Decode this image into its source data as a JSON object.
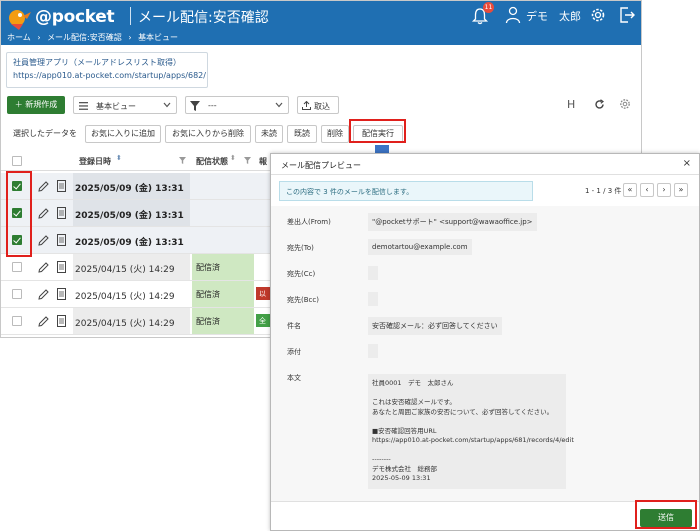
{
  "header": {
    "logo_text": "@pocket",
    "page_title": "メール配信:安否確認",
    "notification_count": "11",
    "user_name": "デモ　太郎",
    "breadcrumb": [
      "ホーム",
      "›",
      "メール配信:安否確認",
      "›",
      "基本ビュー"
    ]
  },
  "app_info": {
    "name": "社員管理アプリ（メールアドレスリスト取得）",
    "url": "https://app010.at-pocket.com/startup/apps/682/"
  },
  "toolbar": {
    "new_label": "＋ 新規作成",
    "view_value": "基本ビュー",
    "filter_value": "---",
    "import_label": "取込",
    "h_label": "H"
  },
  "actions": {
    "prefix": "選択したデータを",
    "buttons": [
      "お気に入りに追加",
      "お気に入りから削除",
      "未読",
      "既読",
      "削除",
      "配信実行"
    ]
  },
  "table": {
    "headers": {
      "date": "登録日時",
      "status": "配信状態",
      "extra": "報"
    },
    "rows": [
      {
        "date": "2025/05/09 (金) 13:31",
        "status": "",
        "chip": "",
        "checked": true
      },
      {
        "date": "2025/05/09 (金) 13:31",
        "status": "",
        "chip": "",
        "checked": true
      },
      {
        "date": "2025/05/09 (金) 13:31",
        "status": "",
        "chip": "",
        "checked": true
      },
      {
        "date": "2025/04/15 (火) 14:29",
        "status": "配信済",
        "chip": "",
        "checked": false
      },
      {
        "date": "2025/04/15 (火) 14:29",
        "status": "配信済",
        "chip": "以",
        "checked": false
      },
      {
        "date": "2025/04/15 (火) 14:29",
        "status": "配信済",
        "chip": "全",
        "checked": false
      }
    ]
  },
  "dialog": {
    "title": "メール配信プレビュー",
    "close": "×",
    "info": "この内容で 3 件のメールを配信します。",
    "pager": "1 - 1 / 3 件",
    "pager_buttons": [
      "«",
      "‹",
      "›",
      "»"
    ],
    "fields": {
      "from_label": "差出人(From)",
      "from_value": "\"@pocketサポート\" <support@wawaoffice.jp>",
      "to_label": "宛先(To)",
      "to_value": "demotartou@example.com",
      "cc_label": "宛先(Cc)",
      "bcc_label": "宛先(Bcc)",
      "subject_label": "件名",
      "subject_value": "安否確認メール：必ず回答してください",
      "attach_label": "添付",
      "body_label": "本文"
    },
    "body_lines": [
      "社員0001　デモ　太郎さん",
      "",
      "これは安否確認メールです。",
      "あなたと周囲ご家族の安否について、必ず回答してください。",
      "",
      "■安否確認回答用URL",
      "https://app010.at-pocket.com/startup/apps/681/records/4/edit",
      "",
      "--------",
      "デモ株式会社　総務部",
      "2025-05-09 13:31"
    ],
    "send_label": "送信"
  },
  "colors": {
    "header_bg": "#1f6fb2",
    "primary_green": "#2e7d32",
    "status_green": "#cfe8c2",
    "annotation_red": "#e0201c",
    "arrow_blue": "#3c74c4"
  }
}
